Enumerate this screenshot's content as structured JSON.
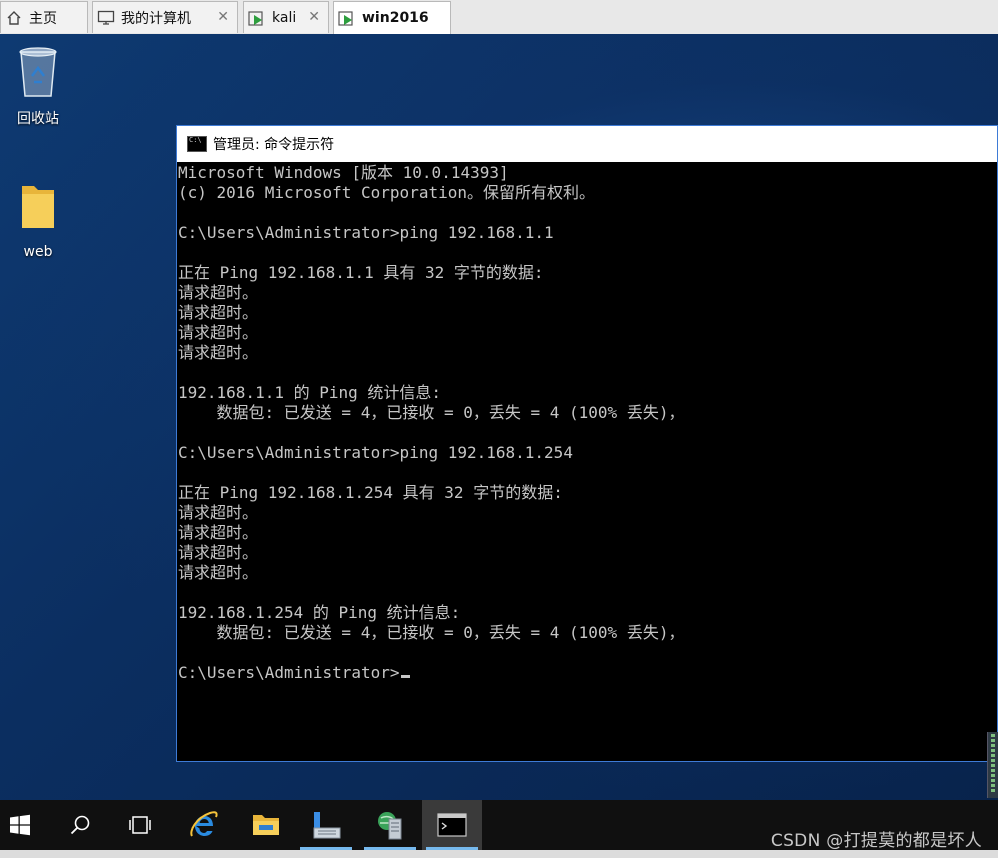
{
  "tabs": [
    {
      "label": "主页",
      "icon": "home-icon",
      "closable": false
    },
    {
      "label": "我的计算机",
      "icon": "computer-icon",
      "closable": true
    },
    {
      "label": "kali",
      "icon": "vm-icon",
      "closable": true
    },
    {
      "label": "win2016",
      "icon": "vm-icon",
      "closable": true,
      "active": true
    }
  ],
  "desktop_icons": [
    {
      "label": "回收站",
      "icon": "recycle-bin-icon"
    },
    {
      "label": "web",
      "icon": "folder-icon"
    }
  ],
  "cmd_window": {
    "title": "管理员: 命令提示符",
    "lines": [
      "Microsoft Windows [版本 10.0.14393]",
      "(c) 2016 Microsoft Corporation。保留所有权利。",
      "",
      "C:\\Users\\Administrator>ping 192.168.1.1",
      "",
      "正在 Ping 192.168.1.1 具有 32 字节的数据:",
      "请求超时。",
      "请求超时。",
      "请求超时。",
      "请求超时。",
      "",
      "192.168.1.1 的 Ping 统计信息:",
      "    数据包: 已发送 = 4，已接收 = 0，丢失 = 4 (100% 丢失)，",
      "",
      "C:\\Users\\Administrator>ping 192.168.1.254",
      "",
      "正在 Ping 192.168.1.254 具有 32 字节的数据:",
      "请求超时。",
      "请求超时。",
      "请求超时。",
      "请求超时。",
      "",
      "192.168.1.254 的 Ping 统计信息:",
      "    数据包: 已发送 = 4，已接收 = 0，丢失 = 4 (100% 丢失)，",
      ""
    ],
    "prompt": "C:\\Users\\Administrator>"
  },
  "taskbar": {
    "items": [
      {
        "name": "start-button",
        "icon": "windows-logo-icon"
      },
      {
        "name": "search-button",
        "icon": "search-icon"
      },
      {
        "name": "task-view-button",
        "icon": "task-view-icon"
      },
      {
        "name": "internet-explorer-button",
        "icon": "ie-icon"
      },
      {
        "name": "file-explorer-button",
        "icon": "folder-icon"
      },
      {
        "name": "server-manager-button",
        "icon": "server-manager-icon"
      },
      {
        "name": "network-app-button",
        "icon": "network-server-icon"
      },
      {
        "name": "cmd-button",
        "icon": "cmd-icon"
      }
    ]
  },
  "watermark": "CSDN @打提莫的都是坏人",
  "colors": {
    "accent": "#3e7bd6",
    "console_text": "#c6c6c6",
    "taskbar": "#101010"
  }
}
